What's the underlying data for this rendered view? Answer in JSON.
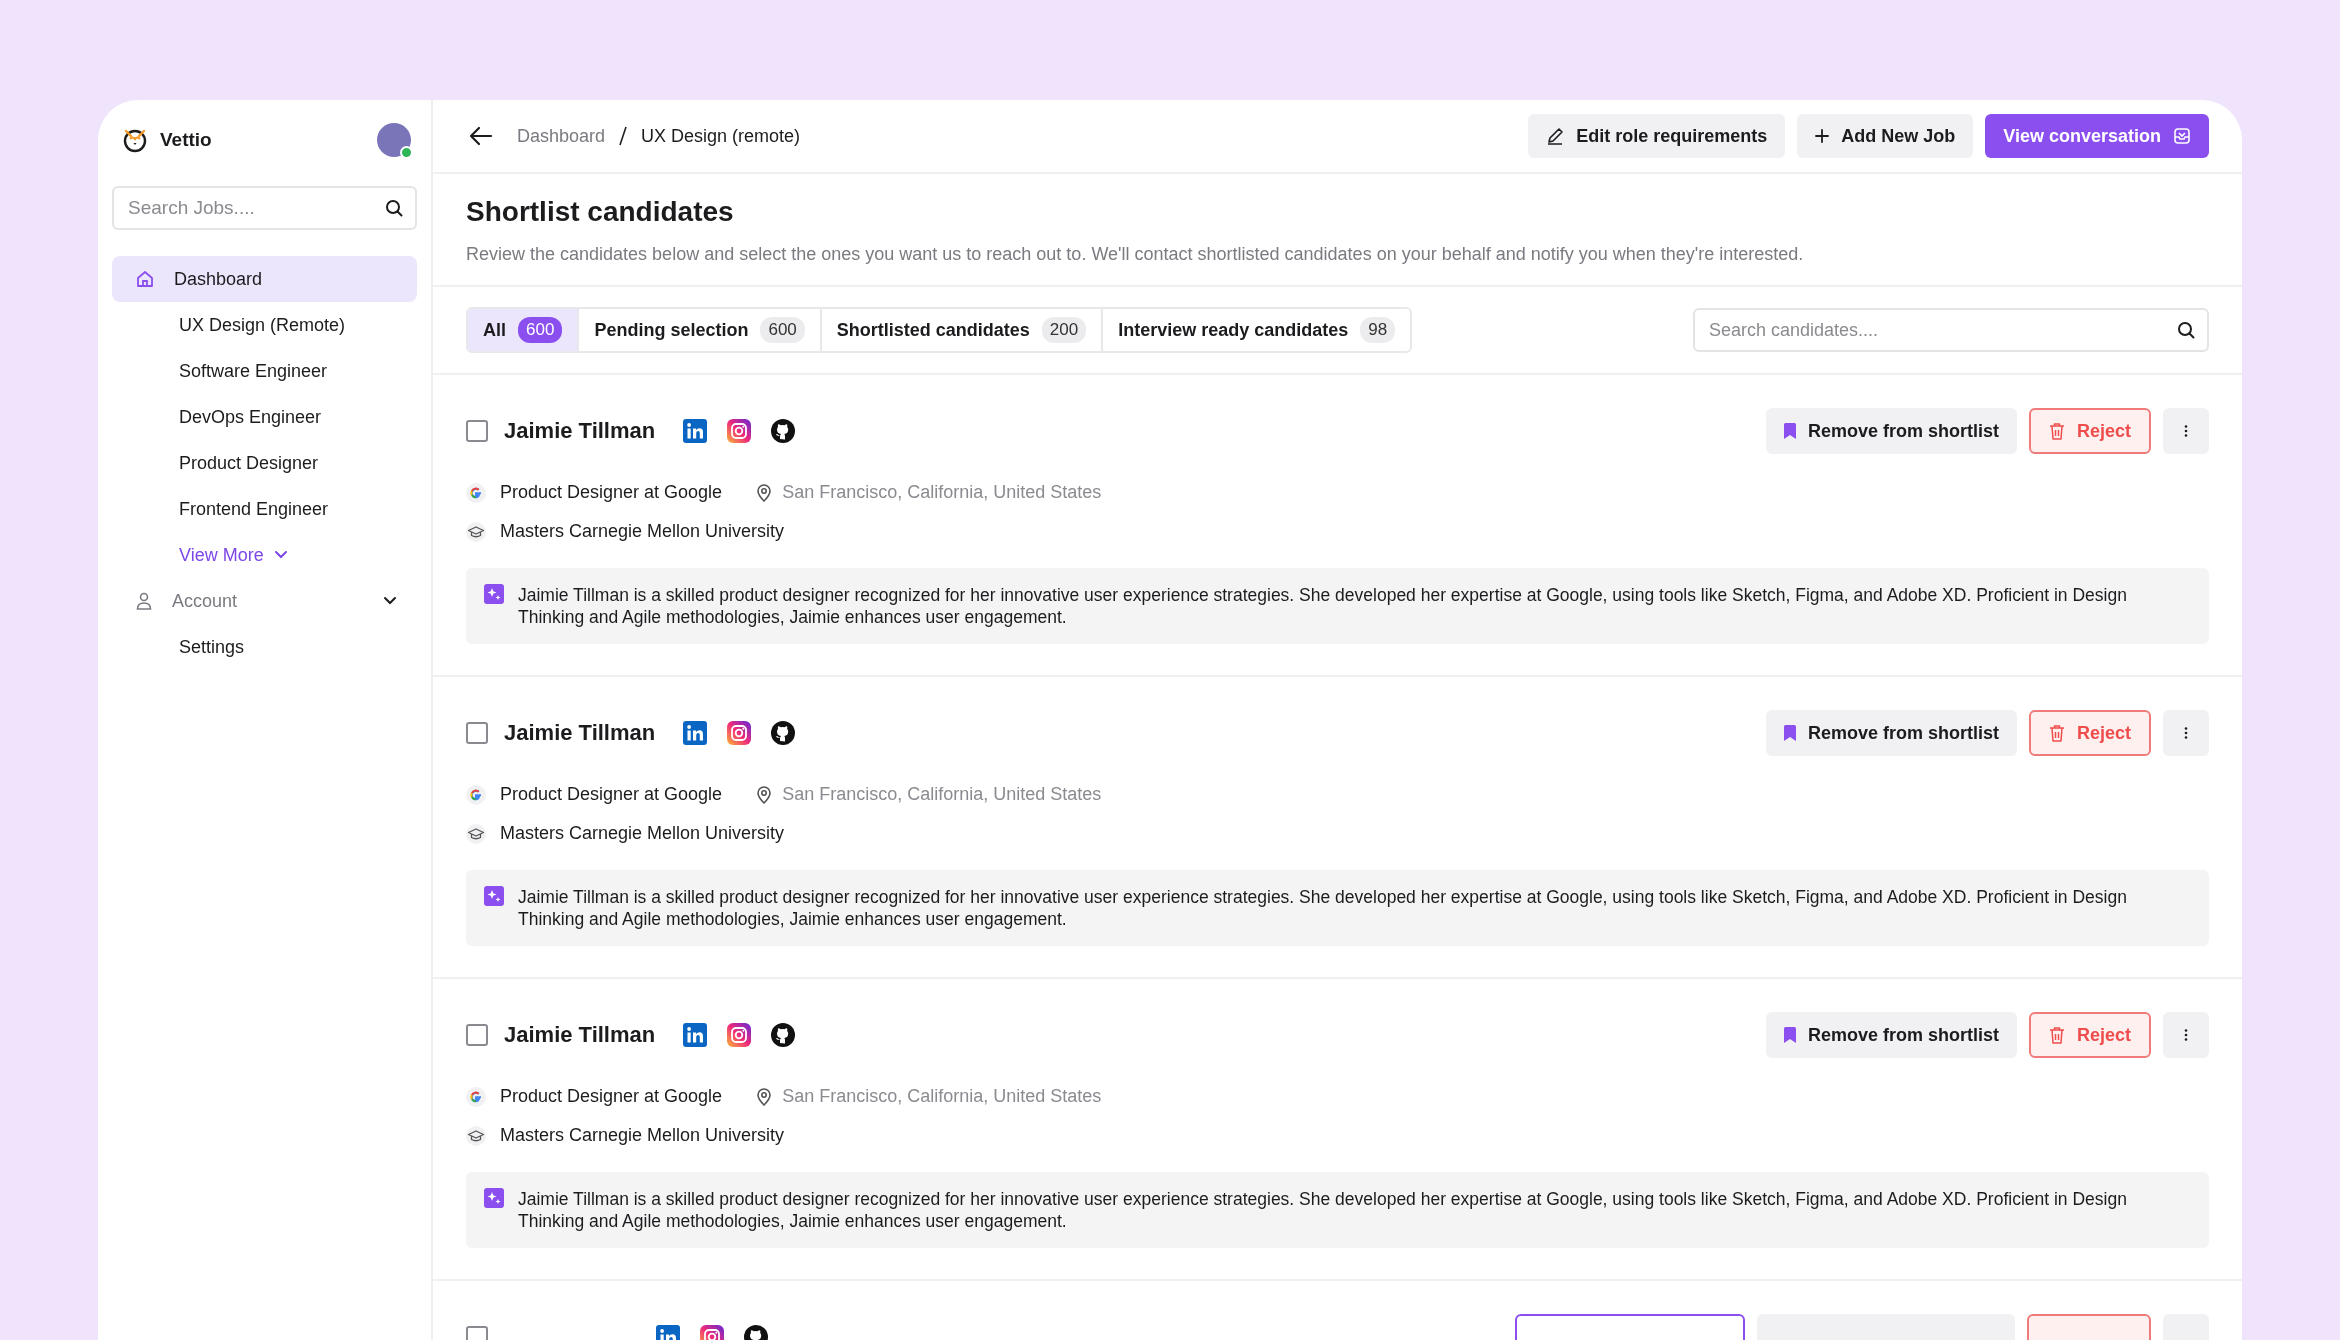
{
  "app": {
    "name": "Vettio"
  },
  "sidebar": {
    "search": {
      "placeholder": "Search Jobs...."
    },
    "items": [
      {
        "label": "Dashboard",
        "kind": "nav",
        "selected": true
      },
      {
        "label": "UX Design (Remote)",
        "kind": "sub",
        "selected": false
      },
      {
        "label": "Software Engineer",
        "kind": "sub",
        "selected": false
      },
      {
        "label": "DevOps Engineer",
        "kind": "sub",
        "selected": false
      },
      {
        "label": "Product Designer",
        "kind": "sub",
        "selected": false
      },
      {
        "label": "Frontend Engineer",
        "kind": "sub",
        "selected": false
      },
      {
        "label": "View More",
        "kind": "more",
        "selected": false
      },
      {
        "label": "Account",
        "kind": "section",
        "selected": false
      },
      {
        "label": "Settings",
        "kind": "sub",
        "selected": false
      }
    ]
  },
  "breadcrumb": [
    "Dashboard",
    "UX Design (remote)"
  ],
  "actions": [
    {
      "label": "Edit role requirements",
      "kind": "edit"
    },
    {
      "label": "Add New Job",
      "kind": "add"
    },
    {
      "label": "View conversation",
      "kind": "conversation"
    }
  ],
  "page": {
    "title": "Shortlist candidates",
    "description": "Review the candidates below and select the ones you want us to reach out to. We'll contact shortlisted candidates on your behalf and notify you when they're interested."
  },
  "tabs": [
    {
      "label": "All",
      "count": "600",
      "selected": true
    },
    {
      "label": "Pending selection",
      "count": "600",
      "selected": false
    },
    {
      "label": "Shortlisted candidates",
      "count": "200",
      "selected": false
    },
    {
      "label": "Interview ready candidates",
      "count": "98",
      "selected": false
    }
  ],
  "candidate_search": {
    "placeholder": "Search candidates...."
  },
  "candidates": [
    {
      "name": "Jaimie Tillman",
      "checked": false,
      "role": "Product Designer at Google",
      "location": "San Francisco, California, United States",
      "education": "Masters Carnegie Mellon University",
      "summary": "Jaimie Tillman is a skilled product designer recognized for her innovative user experience strategies. She developed her expertise at Google, using tools like Sketch, Figma, and Adobe XD. Proficient in Design Thinking and Agile methodologies, Jaimie enhances user engagement.",
      "shortlist_button": "Remove from shortlist",
      "reject_button": "Reject"
    },
    {
      "name": "Jaimie Tillman",
      "checked": false,
      "role": "Product Designer at Google",
      "location": "San Francisco, California, United States",
      "education": "Masters Carnegie Mellon University",
      "summary": "Jaimie Tillman is a skilled product designer recognized for her innovative user experience strategies. She developed her expertise at Google, using tools like Sketch, Figma, and Adobe XD. Proficient in Design Thinking and Agile methodologies, Jaimie enhances user engagement.",
      "shortlist_button": "Remove from shortlist",
      "reject_button": "Reject"
    },
    {
      "name": "Jaimie Tillman",
      "checked": false,
      "role": "Product Designer at Google",
      "location": "San Francisco, California, United States",
      "education": "Masters Carnegie Mellon University",
      "summary": "Jaimie Tillman is a skilled product designer recognized for her innovative user experience strategies. She developed her expertise at Google, using tools like Sketch, Figma, and Adobe XD. Proficient in Design Thinking and Agile methodologies, Jaimie enhances user engagement.",
      "shortlist_button": "Remove from shortlist",
      "reject_button": "Reject"
    }
  ],
  "cut_off_card": {
    "checked": false
  }
}
